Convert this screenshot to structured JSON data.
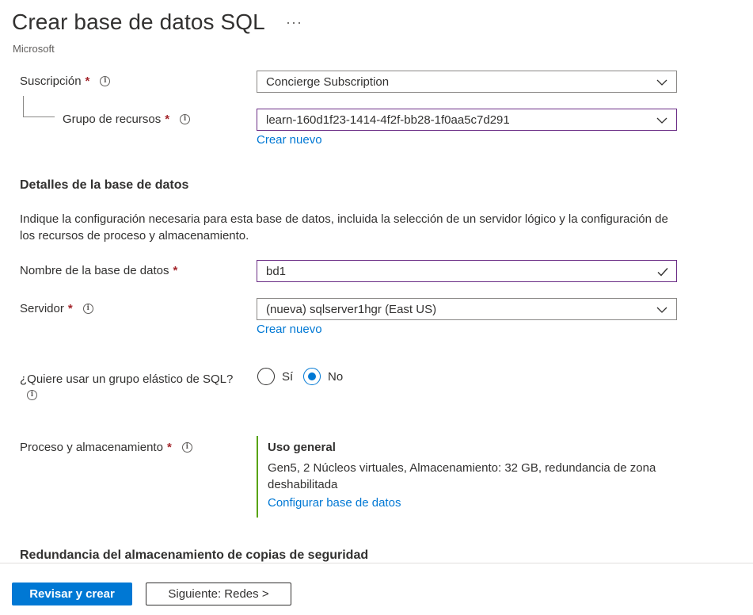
{
  "header": {
    "title": "Crear base de datos SQL",
    "more": "···",
    "publisher": "Microsoft"
  },
  "subscription": {
    "label": "Suscripción",
    "required": "*",
    "value": "Concierge Subscription"
  },
  "resource_group": {
    "label": "Grupo de recursos",
    "required": "*",
    "value": "learn-160d1f23-1414-4f2f-bb28-1f0aa5c7d291",
    "create_new": "Crear nuevo"
  },
  "db_details": {
    "heading": "Detalles de la base de datos",
    "description": "Indique la configuración necesaria para esta base de datos, incluida la selección de un servidor lógico y la configuración de los recursos de proceso y almacenamiento."
  },
  "db_name": {
    "label": "Nombre de la base de datos",
    "required": "*",
    "value": "bd1"
  },
  "server": {
    "label": "Servidor",
    "required": "*",
    "value": "(nueva) sqlserver1hgr (East US)",
    "create_new": "Crear nuevo"
  },
  "elastic_pool": {
    "label": "¿Quiere usar un grupo elástico de SQL?",
    "options": [
      "Sí",
      "No"
    ],
    "selected": "No"
  },
  "compute": {
    "label": "Proceso y almacenamiento",
    "required": "*",
    "tier": "Uso general",
    "details": "Gen5, 2 Núcleos virtuales, Almacenamiento: 32 GB, redundancia de zona deshabilitada",
    "configure_link": "Configurar base de datos"
  },
  "backup": {
    "heading": "Redundancia del almacenamiento de copias de seguridad"
  },
  "footer": {
    "primary_button": "Revisar y crear",
    "secondary_button": "Siguiente: Redes >"
  },
  "colors": {
    "accent": "#0078d4",
    "focus_border": "#6b2d86",
    "required": "#a4262c",
    "compute_bar": "#57a300"
  },
  "icons": [
    "info-icon",
    "chevron-down-icon",
    "checkmark-icon",
    "more-icon"
  ]
}
